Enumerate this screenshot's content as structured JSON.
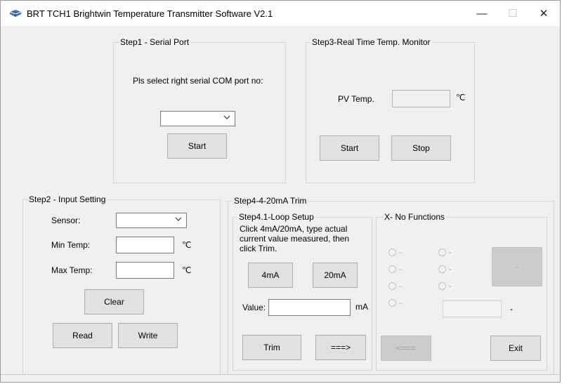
{
  "window": {
    "title": "BRT TCH1 Brightwin Temperature Transmitter Software V2.1",
    "minimize_glyph": "—",
    "maximize_glyph": "☐",
    "close_glyph": "✕"
  },
  "step1": {
    "group_label": "Step1 - Serial Port",
    "prompt": "Pls select right serial COM port no:",
    "com_port_value": "",
    "start_label": "Start"
  },
  "step3": {
    "group_label": "Step3-Real Time Temp. Monitor",
    "pv_label": "PV Temp.",
    "pv_value": "",
    "unit": "℃",
    "start_label": "Start",
    "stop_label": "Stop"
  },
  "step2": {
    "group_label": "Step2 - Input Setting",
    "sensor_label": "Sensor:",
    "sensor_value": "",
    "min_label": "Min Temp:",
    "min_value": "",
    "max_label": "Max Temp:",
    "max_value": "",
    "unit": "℃",
    "clear_label": "Clear",
    "read_label": "Read",
    "write_label": "Write"
  },
  "step4": {
    "group_label": "Step4-4-20mA Trim",
    "loop": {
      "group_label": "Step4.1-Loop Setup",
      "instructions": [
        "Click 4mA/20mA, type actual",
        "current value measured, then",
        "click Trim."
      ],
      "btn_4ma": "4mA",
      "btn_20ma": "20mA",
      "value_label": "Value:",
      "value": "",
      "value_unit": "mA",
      "trim_label": "Trim",
      "next_label": "===>"
    },
    "xfunc": {
      "group_label": "X- No Functions",
      "radio_text": "-",
      "box_label": "-",
      "field_suffix": "-",
      "back_label": "<===",
      "exit_label": "Exit"
    }
  },
  "colors": {
    "window_bg": "#f0f0f0",
    "titlebar_bg": "#ffffff",
    "button_bg": "#e1e1e1",
    "disabled_bg": "#cccccc"
  }
}
